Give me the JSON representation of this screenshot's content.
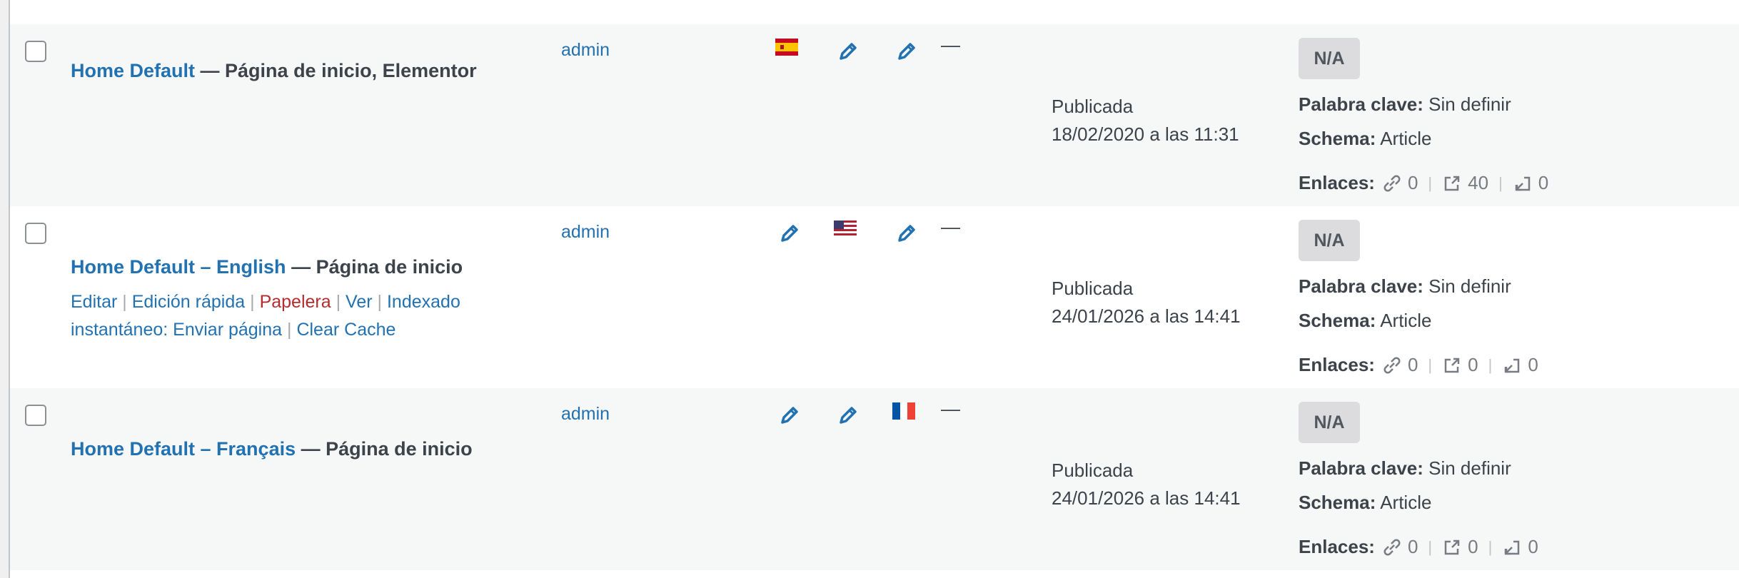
{
  "rows": [
    {
      "title_link": "Home Default",
      "title_state": " — Página de inicio, Elementor",
      "author": "admin",
      "date_status": "Publicada",
      "date_value": "18/02/2020 a las 11:31",
      "badge": "N/A",
      "keyword_label": "Palabra clave:",
      "keyword_value": "Sin definir",
      "schema_label": "Schema:",
      "schema_value": "Article",
      "links_label": "Enlaces:",
      "internal_links": "0",
      "external_links": "40",
      "incoming_links": "0",
      "dash": "—",
      "flag": "spain-flag-icon"
    },
    {
      "title_link": "Home Default – English",
      "title_state": " — Página de inicio",
      "author": "admin",
      "date_status": "Publicada",
      "date_value": "24/01/2026 a las 14:41",
      "badge": "N/A",
      "keyword_label": "Palabra clave:",
      "keyword_value": "Sin definir",
      "schema_label": "Schema:",
      "schema_value": "Article",
      "links_label": "Enlaces:",
      "internal_links": "0",
      "external_links": "0",
      "incoming_links": "0",
      "dash": "—",
      "flag": "usa-flag-icon",
      "actions": {
        "edit": "Editar",
        "quick_edit": "Edición rápida",
        "trash": "Papelera",
        "view": "Ver",
        "instant_index": "Indexado instantáneo: Enviar página",
        "clear_cache": "Clear Cache"
      }
    },
    {
      "title_link": "Home Default – Français",
      "title_state": " — Página de inicio",
      "author": "admin",
      "date_status": "Publicada",
      "date_value": "24/01/2026 a las 14:41",
      "badge": "N/A",
      "keyword_label": "Palabra clave:",
      "keyword_value": "Sin definir",
      "schema_label": "Schema:",
      "schema_value": "Article",
      "links_label": "Enlaces:",
      "internal_links": "0",
      "external_links": "0",
      "incoming_links": "0",
      "dash": "—",
      "flag": "france-flag-icon"
    }
  ],
  "colors": {
    "link": "#2271b1",
    "trash": "#b32d2e",
    "alt_row": "#f6f7f7",
    "badge_bg": "#dcdcde"
  }
}
